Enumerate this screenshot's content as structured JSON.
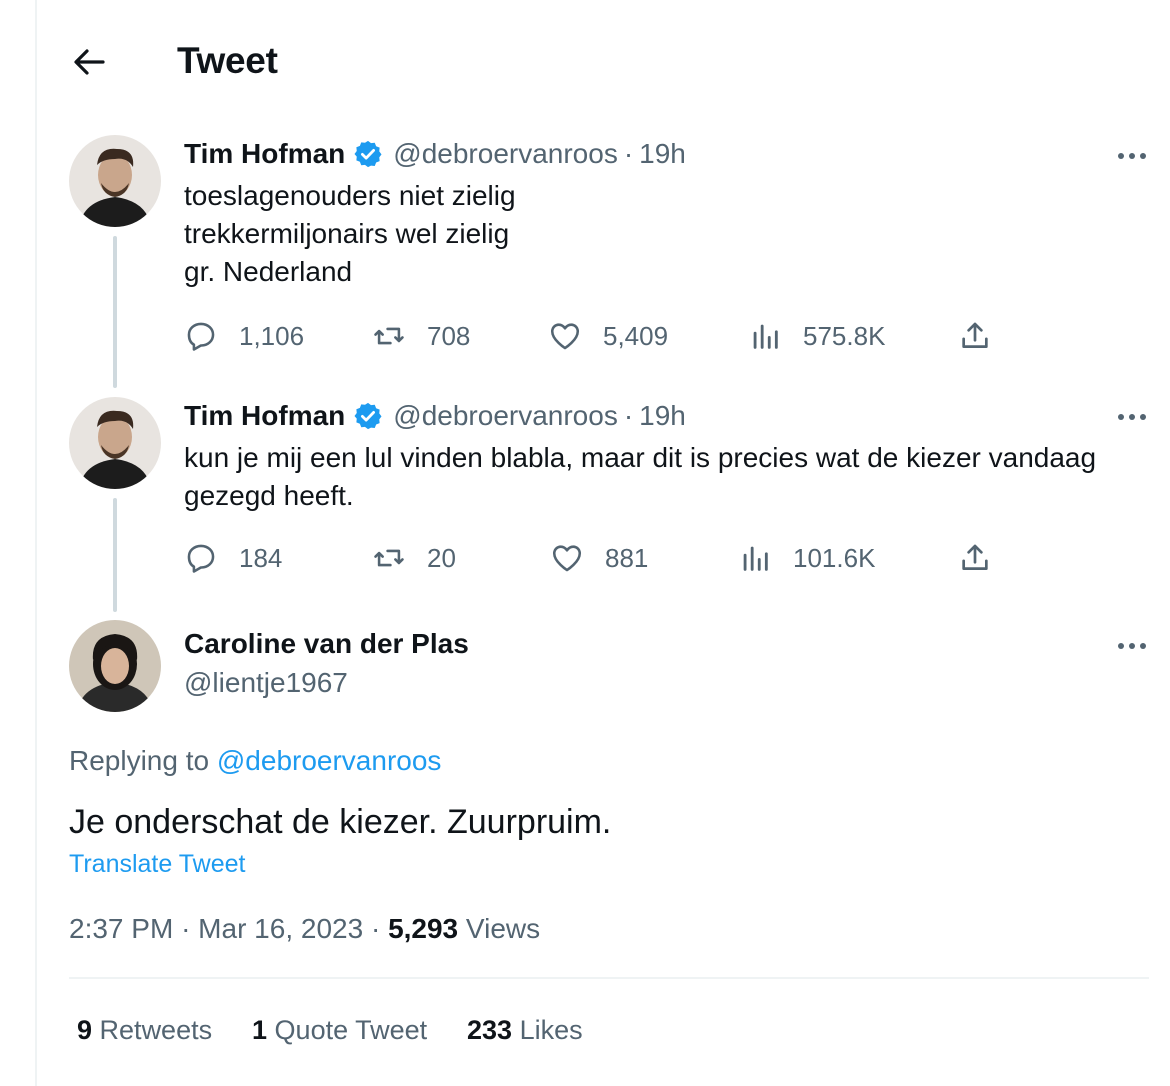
{
  "header": {
    "title": "Tweet"
  },
  "thread": [
    {
      "name": "Tim Hofman",
      "handle": "@debroervanroos",
      "time": "19h",
      "lines": [
        "toeslagenouders niet zielig",
        "trekkermiljonairs wel zielig",
        "gr. Nederland"
      ],
      "replies": "1,106",
      "retweets": "708",
      "likes": "5,409",
      "views": "575.8K"
    },
    {
      "name": "Tim Hofman",
      "handle": "@debroervanroos",
      "time": "19h",
      "lines": [
        "kun je mij een lul vinden blabla, maar dit is precies wat de kiezer vandaag",
        "gezegd heeft."
      ],
      "replies": "184",
      "retweets": "20",
      "likes": "881",
      "views": "101.6K"
    }
  ],
  "main_tweet": {
    "name": "Caroline van der Plas",
    "handle": "@lientje1967",
    "replying_prefix": "Replying to",
    "replying_handle": "@debroervanroos",
    "text": "Je onderschat de kiezer. Zuurpruim.",
    "translate": "Translate Tweet",
    "time": "2:37 PM",
    "date": "Mar 16, 2023",
    "views_count": "5,293",
    "views_label": "Views"
  },
  "stats": {
    "retweets_count": "9",
    "retweets_label": "Retweets",
    "quotes_count": "1",
    "quotes_label": "Quote Tweet",
    "likes_count": "233",
    "likes_label": "Likes"
  },
  "colors": {
    "accent": "#1d9bf0",
    "muted": "#536471",
    "text": "#0f1419",
    "line": "#cfd9de"
  }
}
